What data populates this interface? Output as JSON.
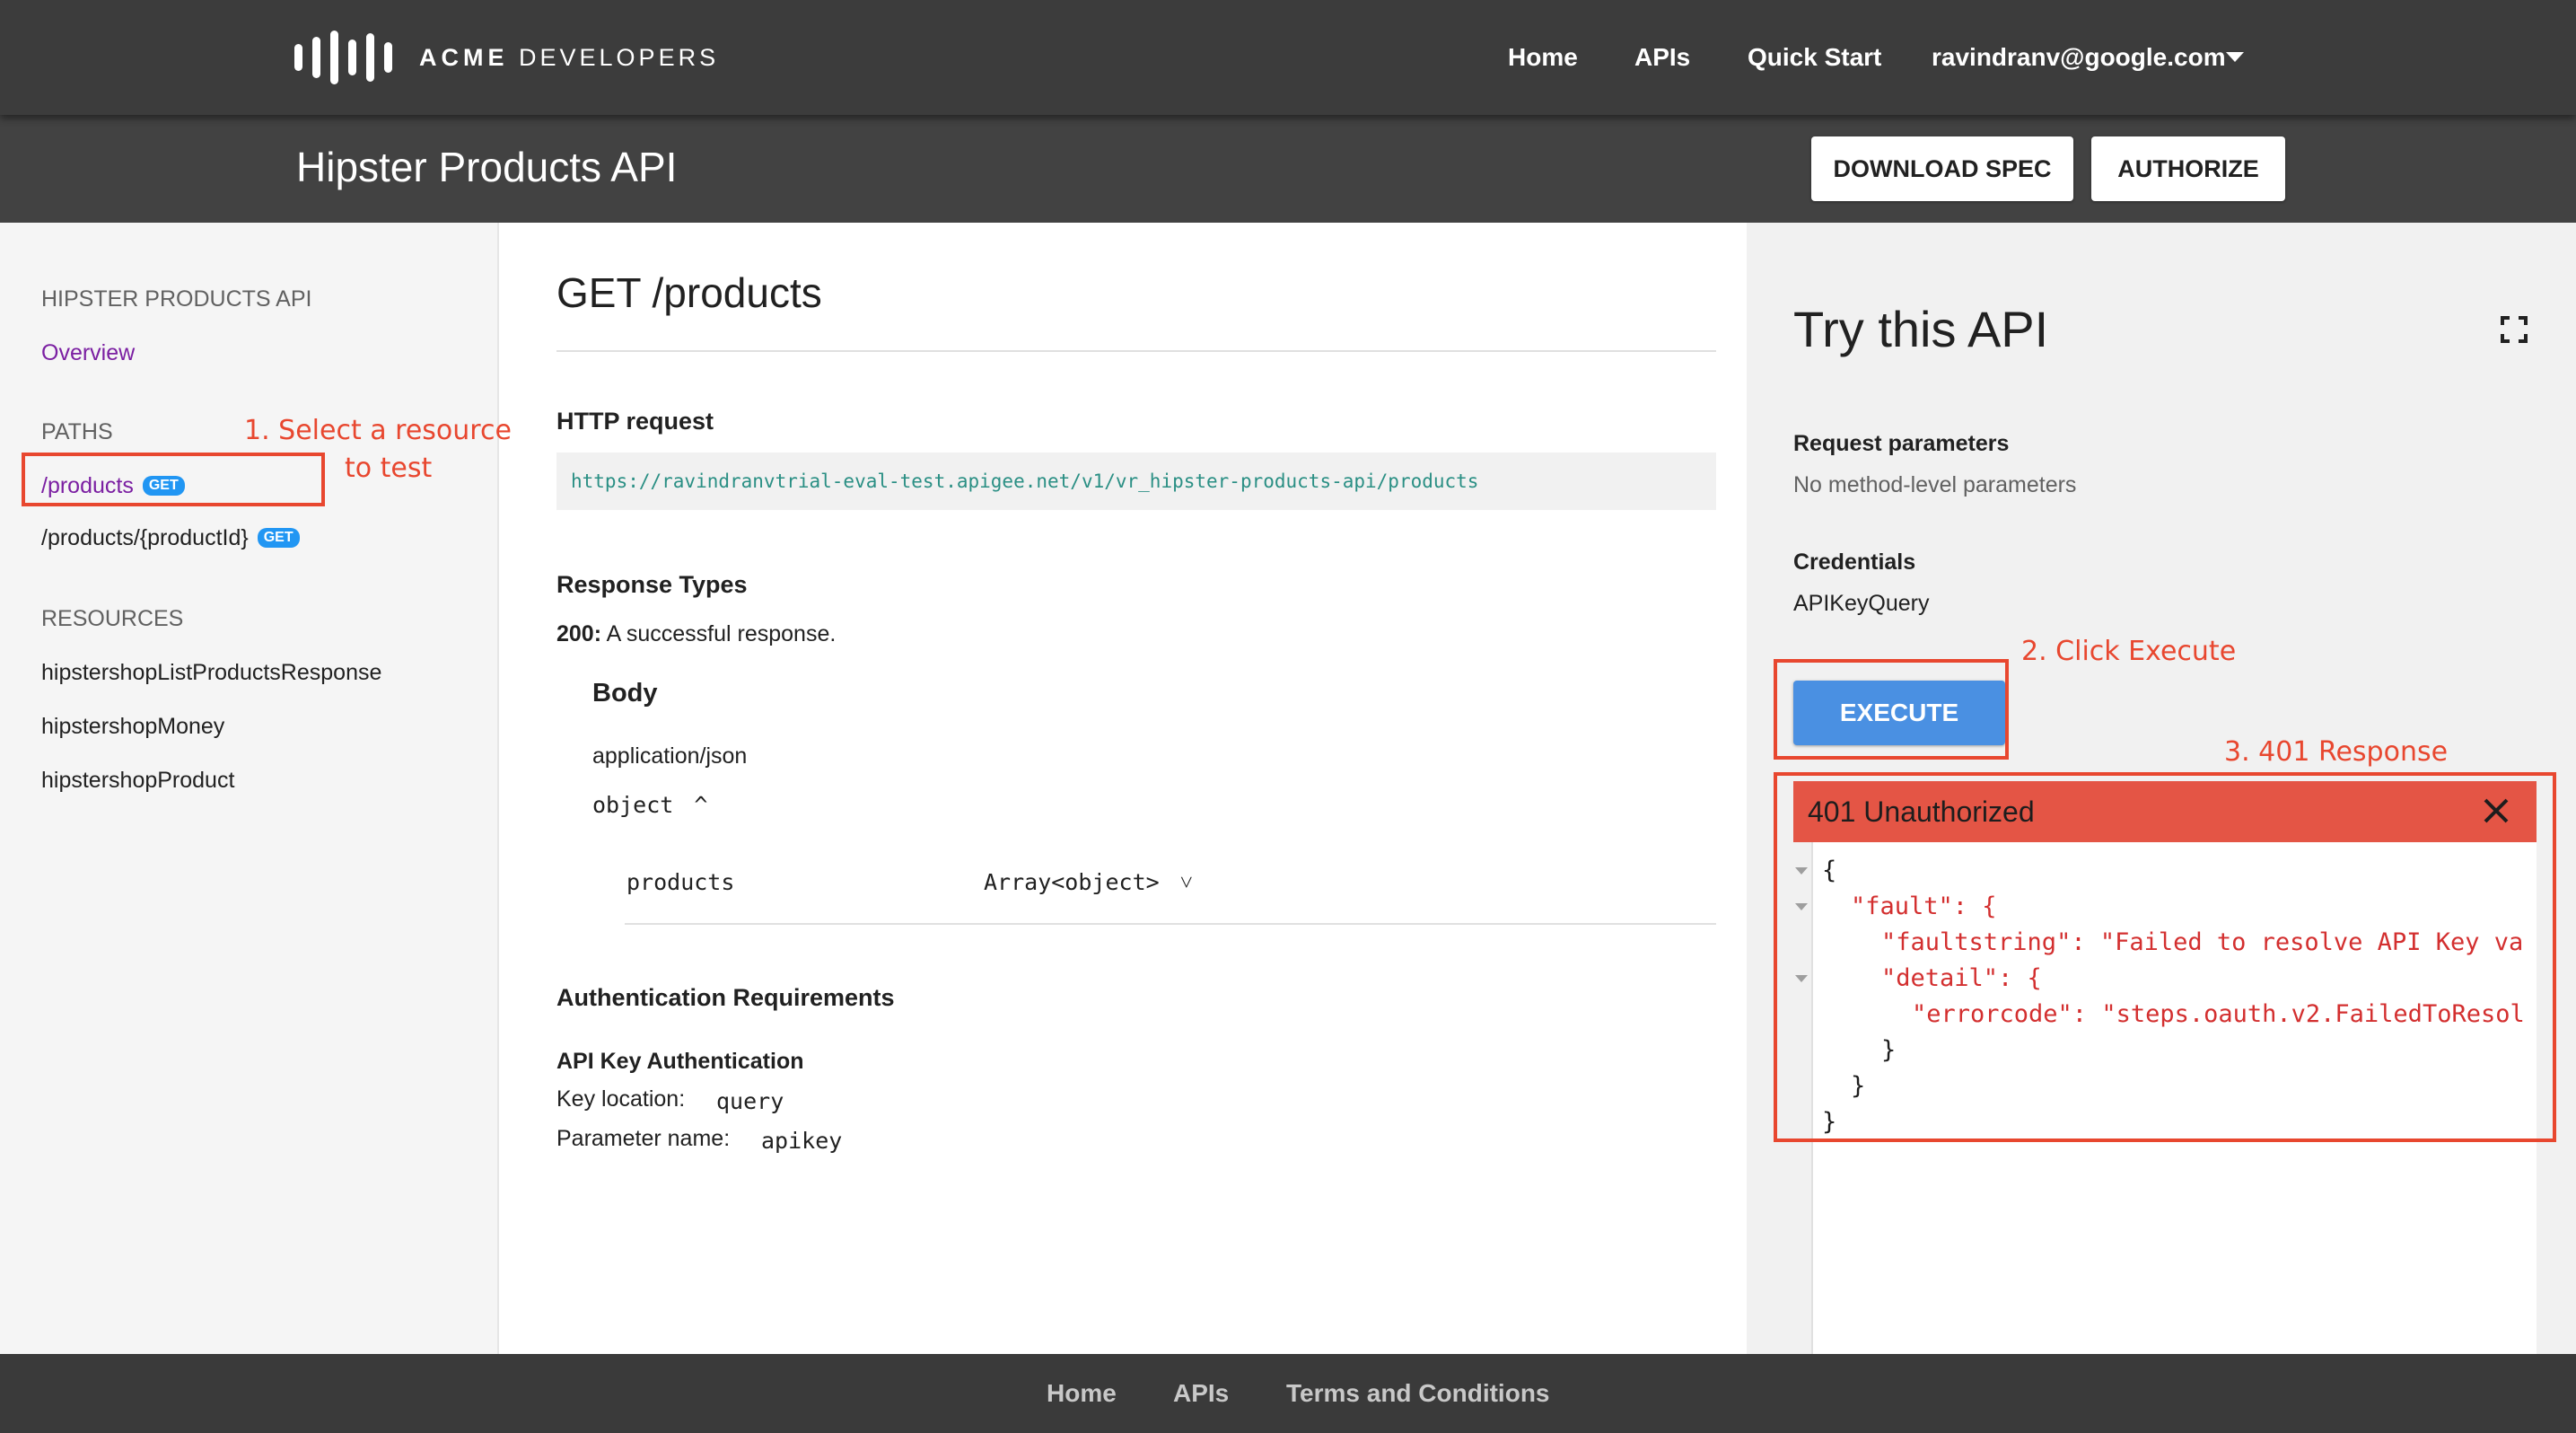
{
  "brand": {
    "logo_bold": "ACME",
    "logo_rest": "DEVELOPERS"
  },
  "topnav": {
    "home": "Home",
    "apis": "APIs",
    "quick_start": "Quick Start",
    "user": "ravindranv@google.com"
  },
  "header": {
    "title": "Hipster Products API",
    "download_spec": "DOWNLOAD SPEC",
    "authorize": "AUTHORIZE"
  },
  "sidebar": {
    "api_heading": "HIPSTER PRODUCTS API",
    "overview": "Overview",
    "paths_heading": "PATHS",
    "paths": [
      {
        "label": "/products",
        "method": "GET"
      },
      {
        "label": "/products/{productId}",
        "method": "GET"
      }
    ],
    "resources_heading": "RESOURCES",
    "resources": [
      "hipstershopListProductsResponse",
      "hipstershopMoney",
      "hipstershopProduct"
    ]
  },
  "annotations": {
    "step1_line1": "1. Select a resource",
    "step1_line2": "to test",
    "step2": "2. Click Execute",
    "step3": "3. 401 Response"
  },
  "main": {
    "endpoint_title": "GET /products",
    "http_request_heading": "HTTP request",
    "request_url": "https://ravindranvtrial-eval-test.apigee.net/v1/vr_hipster-products-api/products",
    "response_types_heading": "Response Types",
    "response_code": "200:",
    "response_desc": "A successful response.",
    "body_heading": "Body",
    "content_type": "application/json",
    "object_label": "object",
    "object_caret": "^",
    "field_name": "products",
    "field_type": "Array<object>",
    "field_caret": "˅",
    "auth_heading": "Authentication Requirements",
    "auth_type": "API Key Authentication",
    "key_location_label": "Key location:",
    "key_location_value": "query",
    "param_name_label": "Parameter name:",
    "param_name_value": "apikey"
  },
  "try_panel": {
    "title": "Try this API",
    "request_params_heading": "Request parameters",
    "request_params_value": "No method-level parameters",
    "credentials_heading": "Credentials",
    "credentials_value": "APIKeyQuery",
    "execute": "EXECUTE",
    "response_status": "401 Unauthorized",
    "response_code_lines": [
      "{",
      "\"fault\": {",
      "\"faultstring\": \"Failed to resolve API Key va",
      "\"detail\": {",
      "\"errorcode\": \"steps.oauth.v2.FailedToResol",
      "}",
      "}",
      "}"
    ]
  },
  "footer": {
    "home": "Home",
    "apis": "APIs",
    "terms": "Terms and Conditions"
  },
  "colors": {
    "topbar": "#3c3c3c",
    "titlebar": "#424242",
    "accent_blue": "#4a90e2",
    "error_red": "#e45545",
    "annotation": "#e8472f",
    "link_purple": "#7b1fa2"
  }
}
